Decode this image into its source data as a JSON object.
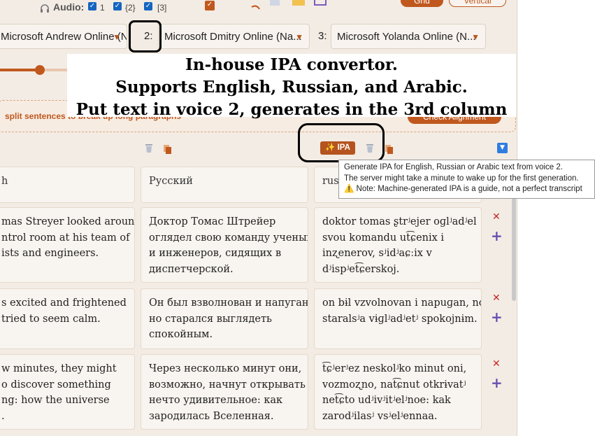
{
  "toolbar": {
    "audio_label": "Audio:",
    "audio_checkboxes": [
      "1",
      "{2}",
      "[3]"
    ],
    "right_button_1": "Grid",
    "right_button_2": "Vertical"
  },
  "voices": {
    "voice1_value": "Microsoft Andrew Online (N...",
    "voice2_number": "2:",
    "voice2_value": "Microsoft Dmitry Online (Na...",
    "voice3_number": "3:",
    "voice3_value": "Microsoft Yolanda Online (N..."
  },
  "banner": {
    "line1": "In-house IPA convertor.",
    "line2": "Supports English, Russian, and Arabic.",
    "line3": "Put text in voice 2, generates in the 3rd column"
  },
  "hint": {
    "split_text": "split sentences to break up long paragraphs",
    "check_alignment": "Check Alignment"
  },
  "ipa_button_label": "✨ IPA",
  "tooltip": {
    "line1": "Generate IPA for English, Russian or Arabic text from voice 2.",
    "line2": "The server might take a minute to wake up for the first generation.",
    "line3": "⚠️ Note: Machine-generated IPA is a guide, not a perfect transcript"
  },
  "headers": [
    "h",
    "Русский",
    "russ"
  ],
  "rows": [
    {
      "english": [
        "mas Streyer looked around",
        "ntrol room at his team of",
        "ists and engineers."
      ],
      "russian": [
        "Доктор Томас Штрейер",
        "оглядел свою команду ученых",
        "и инженеров, сидящих в",
        "диспетчерской."
      ],
      "ipa": [
        "doktor tomas ʂtrʲejer oɡlʲadʲel",
        "svou komandu ut͡ɕenix i",
        "inʐenerov, sʲidʲaɕːix v",
        "dʲispʲet͡ɕerskoj."
      ]
    },
    {
      "english": [
        "s excited and frightened",
        "tried to seem calm."
      ],
      "russian": [
        "Он был взволнован и напуган,",
        "но старался выглядеть",
        "спокойным."
      ],
      "ipa": [
        "on bɨl vzvolnovan i napuɡan, no",
        "staralsʲa vɨɡlʲadʲetʲ spokojnɨm."
      ]
    },
    {
      "english": [
        "w minutes, they might",
        "o discover something",
        "ng: how the universe",
        "."
      ],
      "russian": [
        "Через несколько минут они,",
        "возможно, начнут открывать",
        "нечто удивительное: как",
        "зародилась Вселенная."
      ],
      "ipa": [
        "t͡ɕʲerʲez neskolʲko minut oni,",
        "vozmoʐno, nat͡ɕnut otkrɨvatʲ",
        "net͡ɕto udʲivʲitʲelʲnoe: kak",
        "zarodʲilasʲ vsʲelʲennaa."
      ]
    }
  ]
}
